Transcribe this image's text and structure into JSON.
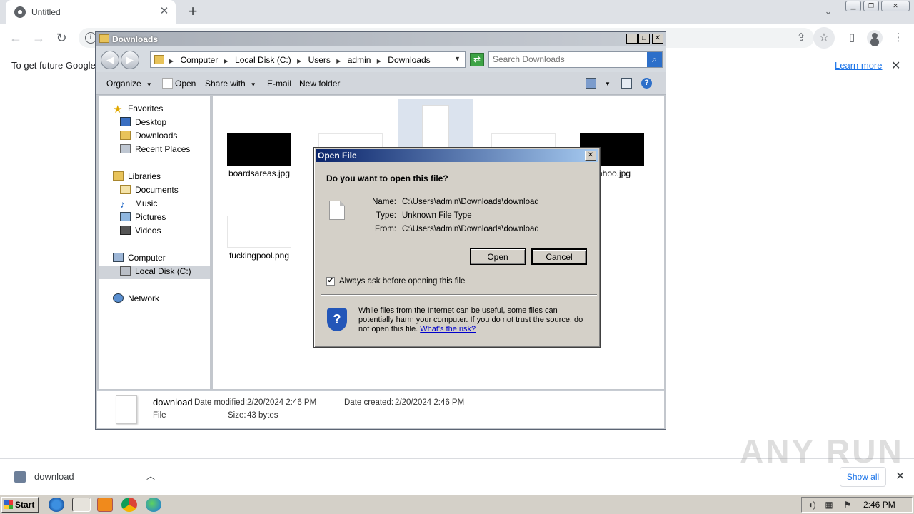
{
  "browser": {
    "tab_title": "Untitled",
    "infobar_text": "To get future Google",
    "learn_more": "Learn more"
  },
  "explorer": {
    "title": "Downloads",
    "breadcrumbs": [
      "Computer",
      "Local Disk (C:)",
      "Users",
      "admin",
      "Downloads"
    ],
    "search_placeholder": "Search Downloads",
    "commands": {
      "organize": "Organize",
      "open": "Open",
      "share_with": "Share with",
      "email": "E-mail",
      "new_folder": "New folder"
    },
    "nav": {
      "favorites": "Favorites",
      "desktop": "Desktop",
      "downloads": "Downloads",
      "recent_places": "Recent Places",
      "libraries": "Libraries",
      "documents": "Documents",
      "music": "Music",
      "pictures": "Pictures",
      "videos": "Videos",
      "computer": "Computer",
      "local_disk": "Local Disk (C:)",
      "network": "Network"
    },
    "files": [
      {
        "name": "boardsareas.jpg"
      },
      {
        "name": "yahoo.jpg"
      },
      {
        "name": "fuckingpool.png"
      }
    ],
    "details": {
      "name": "download",
      "type": "File",
      "modified_label": "Date modified:",
      "modified": "2/20/2024 2:46 PM",
      "created_label": "Date created:",
      "created": "2/20/2024 2:46 PM",
      "size_label": "Size:",
      "size": "43 bytes"
    }
  },
  "dialog": {
    "title": "Open File",
    "question": "Do you want to open this file?",
    "name_label": "Name:",
    "name": "C:\\Users\\admin\\Downloads\\download",
    "type_label": "Type:",
    "type": "Unknown File Type",
    "from_label": "From:",
    "from": "C:\\Users\\admin\\Downloads\\download",
    "open_button": "Open",
    "cancel_button": "Cancel",
    "checkbox_label": "Always ask before opening this file",
    "checkbox_checked": true,
    "warning": "While files from the Internet can be useful, some files can potentially harm your computer. If you do not trust the source, do not open this file.",
    "warning_link": "What's the risk?"
  },
  "download_shelf": {
    "filename": "download",
    "show_all": "Show all"
  },
  "taskbar": {
    "start": "Start",
    "clock": "2:46 PM"
  },
  "watermark": "ANY RUN"
}
